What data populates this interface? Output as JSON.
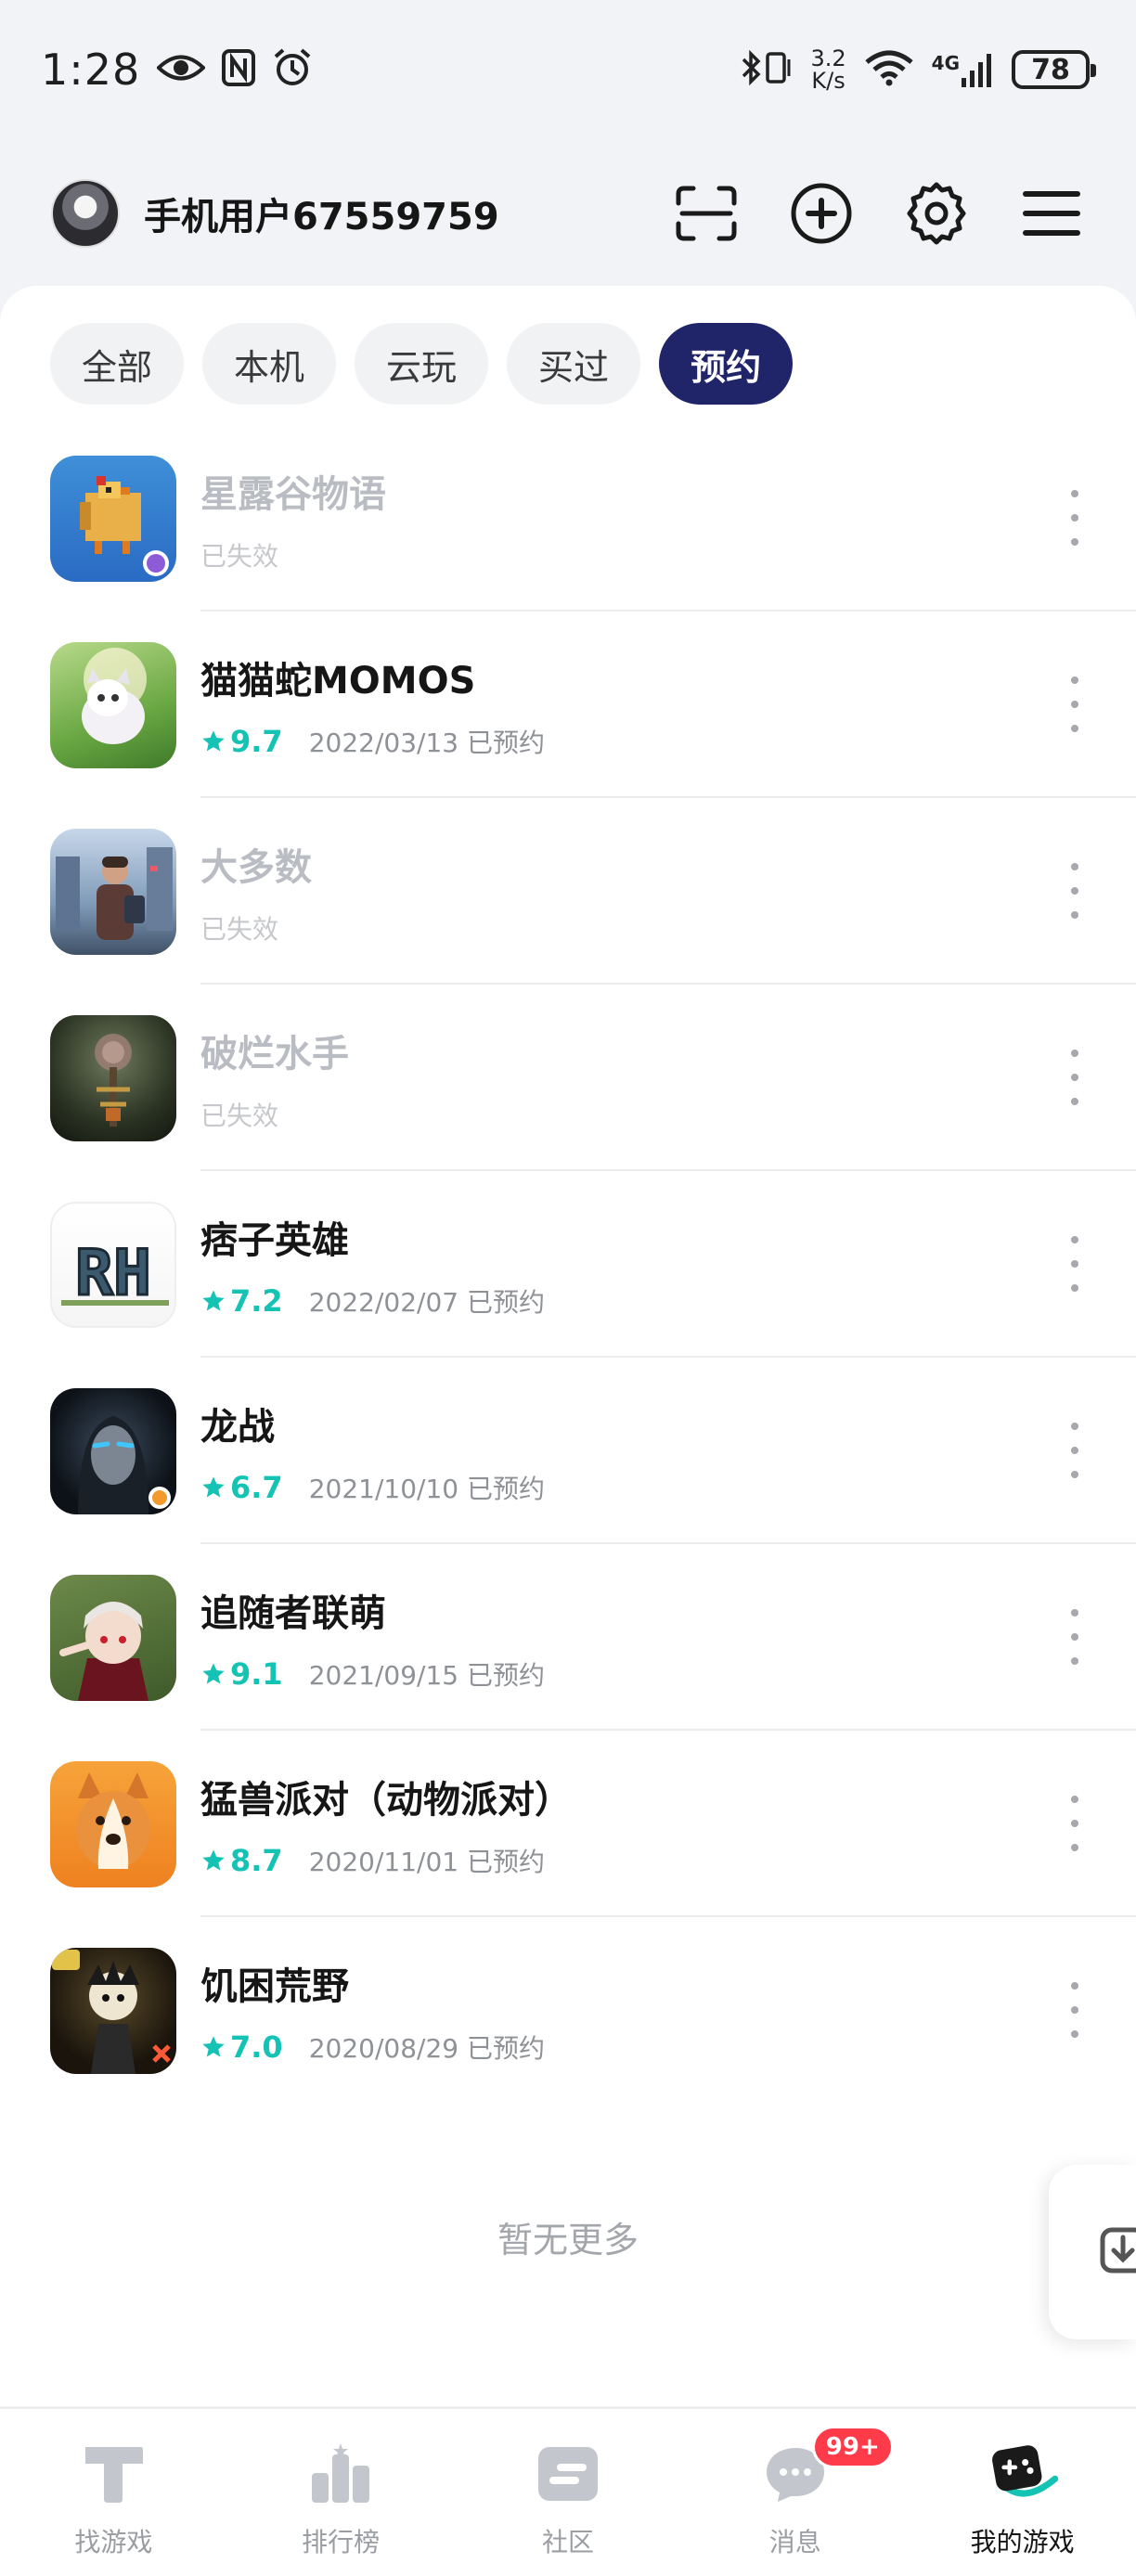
{
  "status_bar": {
    "time": "1:28",
    "net_speed_value": "3.2",
    "net_speed_unit": "K/s",
    "network_type": "4G",
    "battery": "78"
  },
  "header": {
    "username": "手机用户67559759"
  },
  "tabs": [
    {
      "label": "全部",
      "active": false
    },
    {
      "label": "本机",
      "active": false
    },
    {
      "label": "云玩",
      "active": false
    },
    {
      "label": "买过",
      "active": false
    },
    {
      "label": "预约",
      "active": true
    }
  ],
  "games": [
    {
      "name": "星露谷物语",
      "status": "已失效",
      "expired": true,
      "score": "",
      "date": "",
      "date_status": "",
      "icon": "stardew-chicken"
    },
    {
      "name": "猫猫蛇MOMOS",
      "status": "",
      "expired": false,
      "score": "9.7",
      "date": "2022/03/13",
      "date_status": "已预约",
      "icon": "momos-creature"
    },
    {
      "name": "大多数",
      "status": "已失效",
      "expired": true,
      "score": "",
      "date": "",
      "date_status": "",
      "icon": "city-man"
    },
    {
      "name": "破烂水手",
      "status": "已失效",
      "expired": true,
      "score": "",
      "date": "",
      "date_status": "",
      "icon": "dark-sailor"
    },
    {
      "name": "痞子英雄",
      "status": "",
      "expired": false,
      "score": "7.2",
      "date": "2022/02/07",
      "date_status": "已预约",
      "icon": "rh-logo",
      "icon_text": "RH"
    },
    {
      "name": "龙战",
      "status": "",
      "expired": false,
      "score": "6.7",
      "date": "2021/10/10",
      "date_status": "已预约",
      "icon": "dark-hero"
    },
    {
      "name": "追随者联萌",
      "status": "",
      "expired": false,
      "score": "9.1",
      "date": "2021/09/15",
      "date_status": "已预约",
      "icon": "vampire-chibi"
    },
    {
      "name": "猛兽派对（动物派对）",
      "status": "",
      "expired": false,
      "score": "8.7",
      "date": "2020/11/01",
      "date_status": "已预约",
      "icon": "corgi"
    },
    {
      "name": "饥困荒野",
      "status": "",
      "expired": false,
      "score": "7.0",
      "date": "2020/08/29",
      "date_status": "已预约",
      "icon": "dont-starve"
    }
  ],
  "footer_text": "暂无更多",
  "bottom_nav": [
    {
      "label": "找游戏",
      "icon": "find-game-icon",
      "active": false
    },
    {
      "label": "排行榜",
      "icon": "ranking-icon",
      "active": false
    },
    {
      "label": "社区",
      "icon": "community-icon",
      "active": false
    },
    {
      "label": "消息",
      "icon": "message-icon",
      "active": false,
      "badge": "99+"
    },
    {
      "label": "我的游戏",
      "icon": "my-games-icon",
      "active": true
    }
  ],
  "colors": {
    "accent_tab": "#202468",
    "score": "#15c3b4",
    "badge": "#ff3b4a"
  }
}
